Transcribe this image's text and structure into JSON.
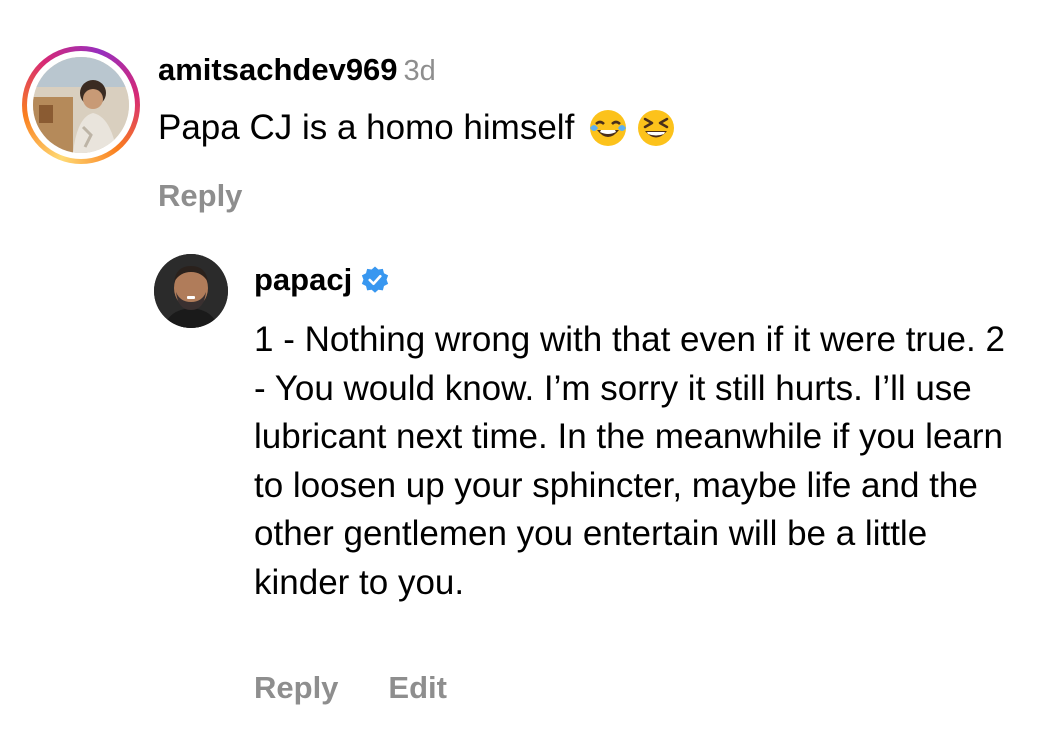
{
  "comment": {
    "username": "amitsachdev969",
    "timestamp": "3d",
    "text": "Papa CJ is a homo himself",
    "emojis": [
      "face-with-tears-of-joy-emoji",
      "grinning-squinting-face-emoji"
    ],
    "reply_label": "Reply"
  },
  "reply": {
    "username": "papacj",
    "verified": true,
    "verified_color": "#3897f0",
    "text": "1 - Nothing wrong with that even if it were true. 2 - You would know. I’m sorry it still hurts. I’ll use lubricant next time. In the meanwhile if you learn to loosen up your sphincter, maybe life and the other gentlemen you entertain will be a little kinder to you.",
    "reply_label": "Reply",
    "edit_label": "Edit"
  },
  "colors": {
    "secondary_text": "#8e8e8e",
    "primary_text": "#000000",
    "story_ring": [
      "#feda75",
      "#fa7e1e",
      "#d62976",
      "#962fbf"
    ]
  }
}
